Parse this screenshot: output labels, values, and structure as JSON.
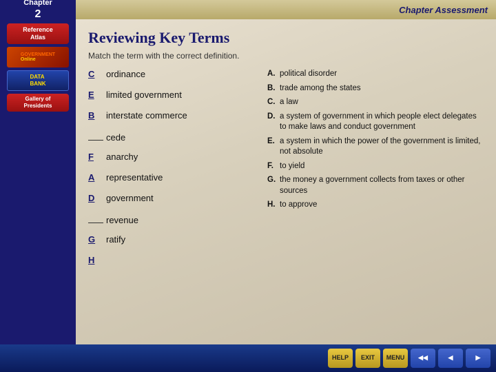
{
  "header": {
    "chapter_label": "Chapter",
    "chapter_number": "2",
    "assessment_label": "Chapter Assessment"
  },
  "sidebar": {
    "items": [
      {
        "id": "reference-atlas",
        "label": "Reference\nAtlas"
      },
      {
        "id": "government-online",
        "label": "GOVERNMENT Online"
      },
      {
        "id": "data-bank",
        "label": "DATA\nBANK"
      },
      {
        "id": "gallery-of-presidents",
        "label": "Gallery of\nPresidents"
      }
    ]
  },
  "page": {
    "title": "Reviewing Key Terms",
    "instruction": "Match the term with the correct definition."
  },
  "terms": [
    {
      "blank": "C",
      "text": "ordinance"
    },
    {
      "blank": "E",
      "text": "limited government"
    },
    {
      "blank": "B",
      "text": "interstate commerce"
    },
    {
      "blank": "",
      "text": "cede"
    },
    {
      "blank": "F",
      "text": "anarchy"
    },
    {
      "blank": "A",
      "text": "representative"
    },
    {
      "blank": "D",
      "text": "government"
    },
    {
      "blank": "",
      "text": "revenue"
    },
    {
      "blank": "G",
      "text": "ratify"
    },
    {
      "blank": "H",
      "text": ""
    }
  ],
  "definitions": [
    {
      "letter": "A.",
      "text": "political disorder"
    },
    {
      "letter": "B.",
      "text": "trade among the states"
    },
    {
      "letter": "C.",
      "text": "a law"
    },
    {
      "letter": "D.",
      "text": "a system of government in which people elect delegates to make laws and conduct government"
    },
    {
      "letter": "E.",
      "text": "a system in which the power of the government is limited, not absolute"
    },
    {
      "letter": "F.",
      "text": "to yield"
    },
    {
      "letter": "G.",
      "text": "the money a government collects from taxes or other sources"
    },
    {
      "letter": "H.",
      "text": "to approve"
    }
  ],
  "nav": {
    "help": "HELP",
    "exit": "EXIT",
    "menu": "MENU",
    "prev_back": "◀◀",
    "prev": "◀",
    "next": "▶"
  }
}
